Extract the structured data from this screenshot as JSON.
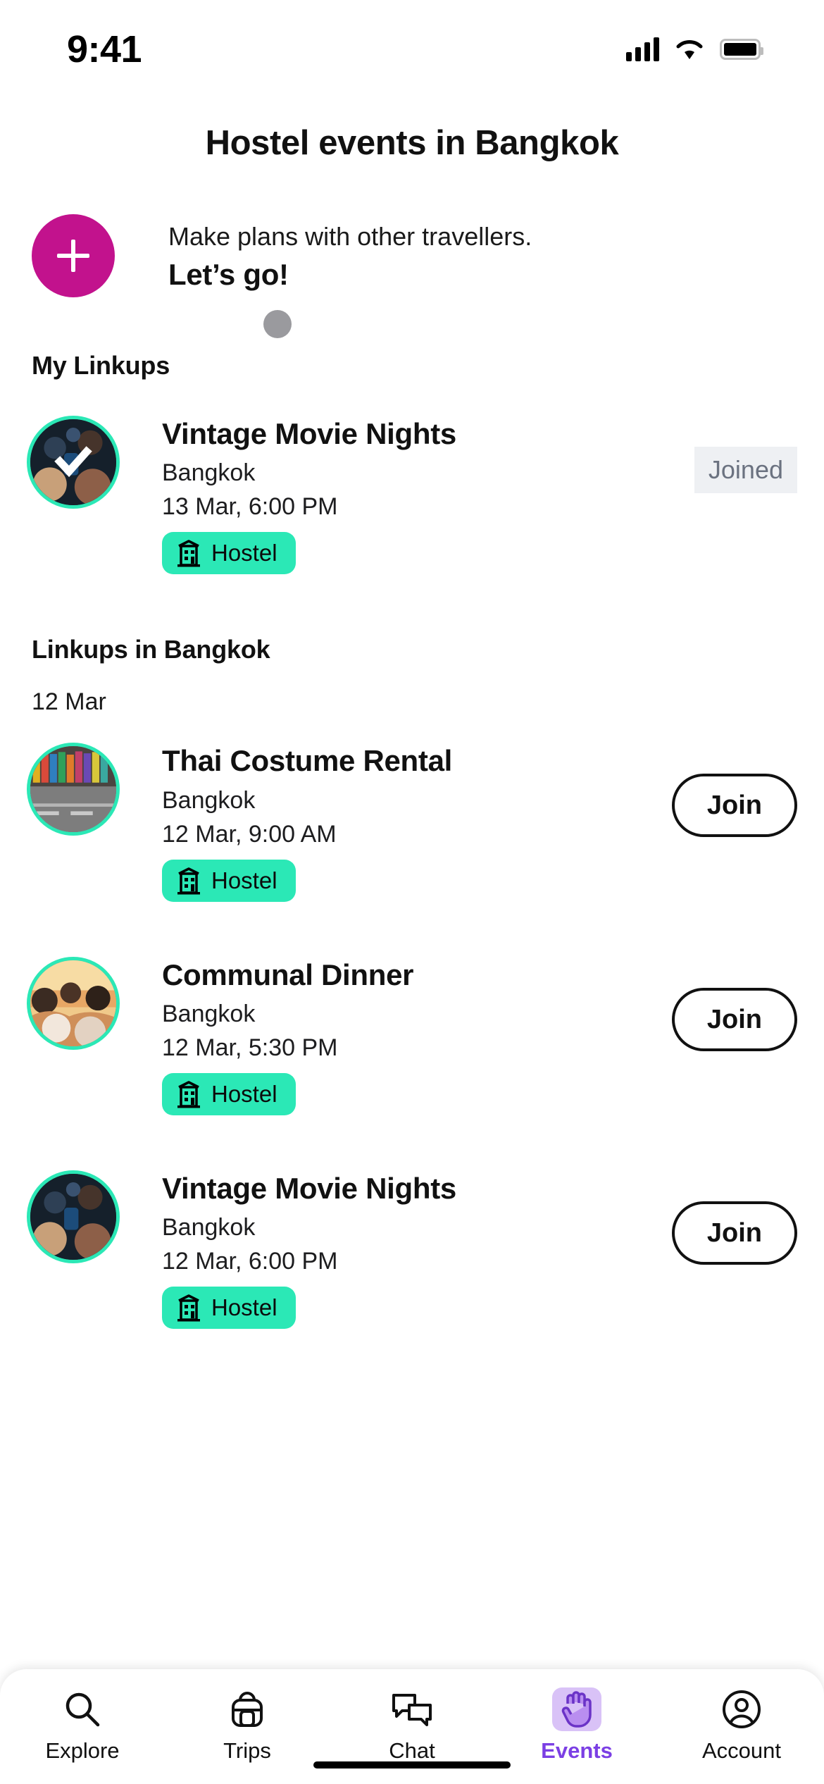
{
  "status_bar": {
    "time": "9:41",
    "cellular_icon": "signal-bars-icon",
    "wifi_icon": "wifi-icon",
    "battery_icon": "battery-full-icon"
  },
  "header": {
    "title": "Hostel events in Bangkok"
  },
  "cta": {
    "plus_icon": "plus-icon",
    "subtitle": "Make plans with other travellers.",
    "title": "Let’s go!"
  },
  "sections": {
    "my_linkups_title": "My Linkups",
    "city_linkups_title": "Linkups in Bangkok",
    "date_group": "12 Mar"
  },
  "my_linkups": [
    {
      "name": "Vintage Movie Nights",
      "city": "Bangkok",
      "time": "13 Mar, 6:00 PM",
      "tag": "Hostel",
      "tag_icon": "hostel-building-icon",
      "action_label": "Joined",
      "action_state": "joined",
      "avatar_alt": "crowd-at-concert-photo",
      "check_icon": "check-icon"
    }
  ],
  "city_linkups": [
    {
      "name": "Thai Costume Rental",
      "city": "Bangkok",
      "time": "12 Mar, 9:00 AM",
      "tag": "Hostel",
      "tag_icon": "hostel-building-icon",
      "action_label": "Join",
      "action_state": "join",
      "avatar_alt": "costume-shop-street-photo"
    },
    {
      "name": "Communal Dinner",
      "city": "Bangkok",
      "time": "12 Mar, 5:30 PM",
      "tag": "Hostel",
      "tag_icon": "hostel-building-icon",
      "action_label": "Join",
      "action_state": "join",
      "avatar_alt": "friends-at-sunset-photo"
    },
    {
      "name": "Vintage Movie Nights",
      "city": "Bangkok",
      "time": "12 Mar, 6:00 PM",
      "tag": "Hostel",
      "tag_icon": "hostel-building-icon",
      "action_label": "Join",
      "action_state": "join",
      "avatar_alt": "crowd-at-concert-photo"
    }
  ],
  "tabbar": {
    "items": [
      {
        "label": "Explore",
        "icon": "search-icon",
        "active": false
      },
      {
        "label": "Trips",
        "icon": "backpack-icon",
        "active": false
      },
      {
        "label": "Chat",
        "icon": "chat-bubbles-icon",
        "active": false
      },
      {
        "label": "Events",
        "icon": "waving-hand-icon",
        "active": true
      },
      {
        "label": "Account",
        "icon": "person-circle-icon",
        "active": false
      }
    ]
  },
  "colors": {
    "accent_magenta": "#C2128D",
    "accent_teal": "#2BE8B6",
    "accent_purple": "#7B3FE4",
    "badge_gray_bg": "#EEF0F3",
    "badge_gray_text": "#6B7280"
  }
}
